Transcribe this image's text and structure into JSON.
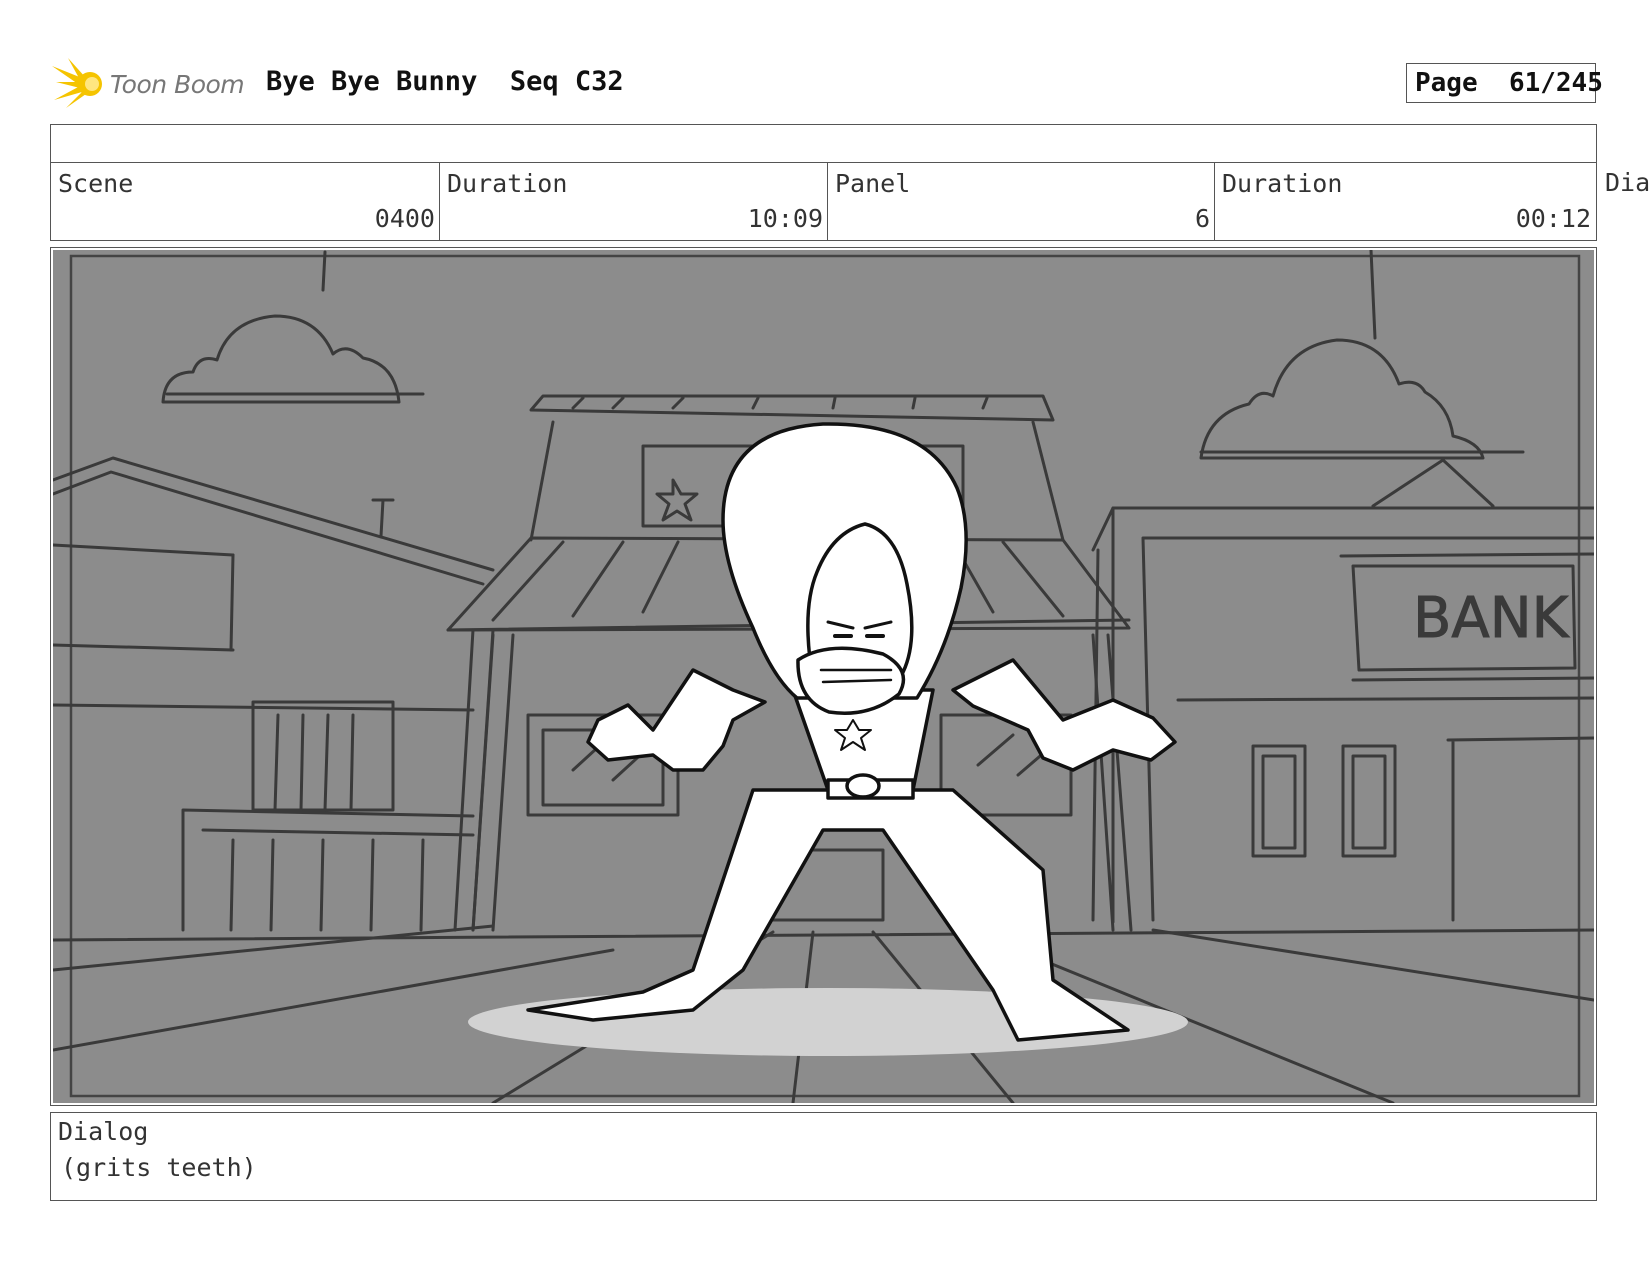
{
  "header": {
    "logo_text": "Toon Boom",
    "project_title": "Bye Bye Bunny",
    "sequence": "Seq C32",
    "page_label": "Page",
    "page_number": "61/245"
  },
  "info_row": {
    "scene_label": "Scene",
    "scene_value": "0400",
    "scene_duration_label": "Duration",
    "scene_duration_value": "10:09",
    "panel_label": "Panel",
    "panel_value": "6",
    "panel_duration_label": "Duration",
    "panel_duration_value": "00:12",
    "overflow_label": "Dia"
  },
  "panel_image": {
    "sign_text": "BANK"
  },
  "dialog": {
    "label": "Dialog",
    "text": "(grits teeth)"
  },
  "colors": {
    "panel_background": "#8c8c8c",
    "line_color": "#3a3a3a",
    "logo_accent": "#f5c400"
  }
}
